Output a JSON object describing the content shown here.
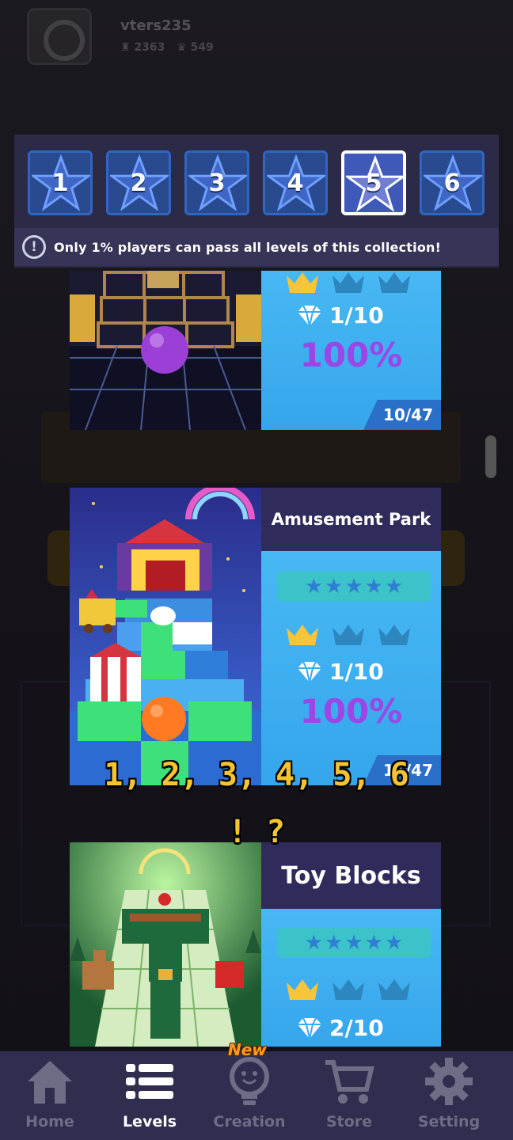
{
  "profile": {
    "username": "vters235",
    "stat_trophies": "2363",
    "stat_crowns": "549"
  },
  "collection_tabs": [
    {
      "label": "1",
      "active": false
    },
    {
      "label": "2",
      "active": false
    },
    {
      "label": "3",
      "active": false
    },
    {
      "label": "4",
      "active": false
    },
    {
      "label": "5",
      "active": true
    },
    {
      "label": "6",
      "active": false
    }
  ],
  "notice": {
    "icon": "info-icon",
    "glyph": "!",
    "text": "Only 1%  players can pass all levels of this collection!"
  },
  "levels": [
    {
      "title": "",
      "crowns_earned": 1,
      "crowns_total": 3,
      "gems": "1/10",
      "percent": "100%",
      "progress": "10/47"
    },
    {
      "title": "Amusement Park",
      "stars_filled": 0,
      "stars_total": 5,
      "crowns_earned": 1,
      "crowns_total": 3,
      "gems": "1/10",
      "percent": "100%",
      "progress": "11/47"
    },
    {
      "title": "Toy Blocks",
      "stars_filled": 0,
      "stars_total": 5,
      "crowns_earned": 1,
      "crowns_total": 3,
      "gems": "2/10",
      "percent": ""
    }
  ],
  "caption": {
    "line1": "1, 2, 3, 4, 5, 6",
    "line2": "! ?"
  },
  "bottom_nav": [
    {
      "label": "Home",
      "icon": "home-icon",
      "active": false
    },
    {
      "label": "Levels",
      "icon": "list-icon",
      "active": true
    },
    {
      "label": "Creation",
      "icon": "lightbulb-icon",
      "active": false,
      "badge": "New"
    },
    {
      "label": "Store",
      "icon": "cart-icon",
      "active": false
    },
    {
      "label": "Setting",
      "icon": "gear-icon",
      "active": false
    }
  ],
  "colors": {
    "panel": "#2c2b47",
    "tab_fill": "#2a4a8f",
    "card_side": "#3ea9ee",
    "percent": "#9b46e6",
    "caption": "#f4c430",
    "nav_bg": "#2f2e4e"
  }
}
